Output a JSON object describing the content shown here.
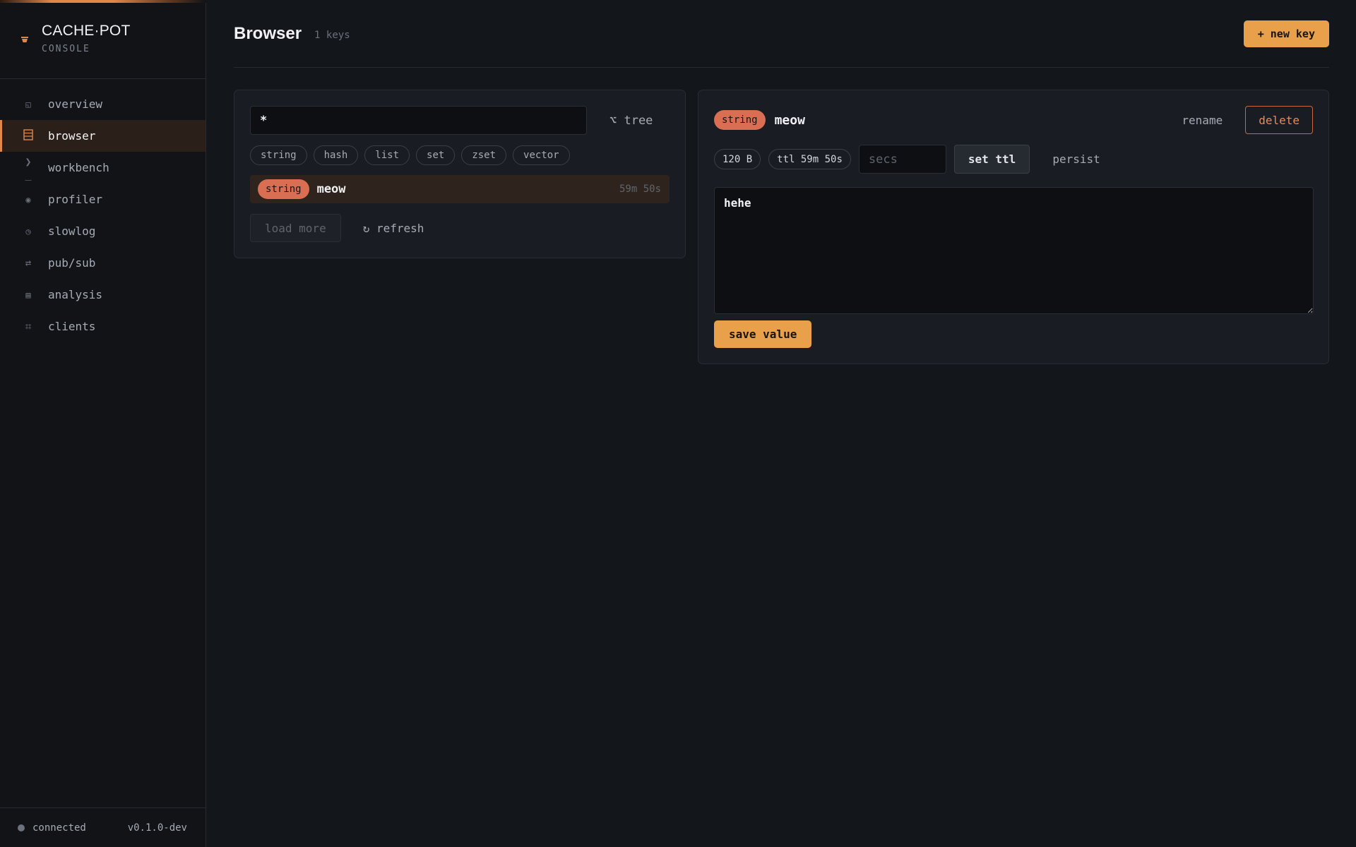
{
  "sidebar": {
    "brand_title": "CACHE·POT",
    "brand_subtitle": "CONSOLE",
    "items": [
      {
        "label": "overview",
        "icon": "overview-icon",
        "active": false
      },
      {
        "label": "browser",
        "icon": "browser-icon",
        "active": true
      },
      {
        "label": "workbench",
        "icon": "terminal-icon",
        "active": false
      },
      {
        "label": "profiler",
        "icon": "profiler-icon",
        "active": false
      },
      {
        "label": "slowlog",
        "icon": "clock-icon",
        "active": false
      },
      {
        "label": "pub/sub",
        "icon": "arrows-icon",
        "active": false
      },
      {
        "label": "analysis",
        "icon": "analysis-icon",
        "active": false
      },
      {
        "label": "clients",
        "icon": "hash-icon",
        "active": false
      }
    ],
    "status": "connected",
    "version": "v0.1.0-dev"
  },
  "header": {
    "title": "Browser",
    "key_count": "1 keys",
    "new_key_label": "+ new key"
  },
  "list": {
    "search_value": "*",
    "tree_label": "⌥ tree",
    "filters": [
      "string",
      "hash",
      "list",
      "set",
      "zset",
      "vector"
    ],
    "keys": [
      {
        "type": "string",
        "name": "meow",
        "ttl": "59m 50s"
      }
    ],
    "load_more_label": "load more",
    "refresh_label": "↻ refresh"
  },
  "detail": {
    "type": "string",
    "key": "meow",
    "rename_label": "rename",
    "delete_label": "delete",
    "size": "120 B",
    "ttl": "ttl 59m 50s",
    "secs_placeholder": "secs",
    "set_ttl_label": "set ttl",
    "persist_label": "persist",
    "value": "hehe",
    "save_label": "save value"
  },
  "colors": {
    "accent": "#e8a04a",
    "string_badge": "#d96e52",
    "background": "#13161b"
  }
}
